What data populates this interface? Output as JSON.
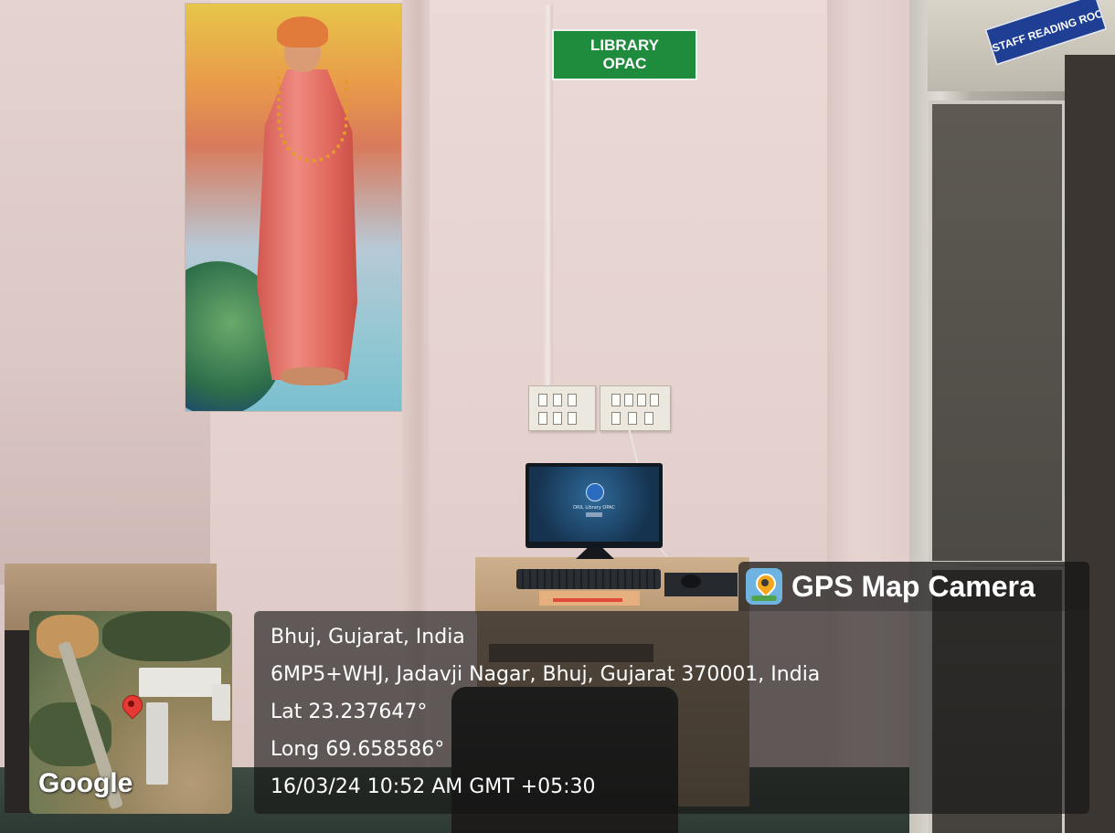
{
  "scene": {
    "library_sign": {
      "line1": "LIBRARY",
      "line2": "OPAC",
      "color": "#1f8b3d"
    },
    "staff_sign": {
      "text": "STAFF READING ROOM",
      "color": "#1f3f94"
    },
    "monitor_screen_text": "DRIL Library OPAC"
  },
  "overlay": {
    "brand": "GPS Map Camera",
    "icon": "map-pin-icon",
    "city": "Bhuj, Gujarat, India",
    "address": "6MP5+WHJ, Jadavji Nagar, Bhuj, Gujarat 370001, India",
    "latitude": "Lat 23.237647°",
    "longitude": "Long 69.658586°",
    "timestamp": "16/03/24 10:52 AM GMT +05:30",
    "map_logo": "Google"
  }
}
